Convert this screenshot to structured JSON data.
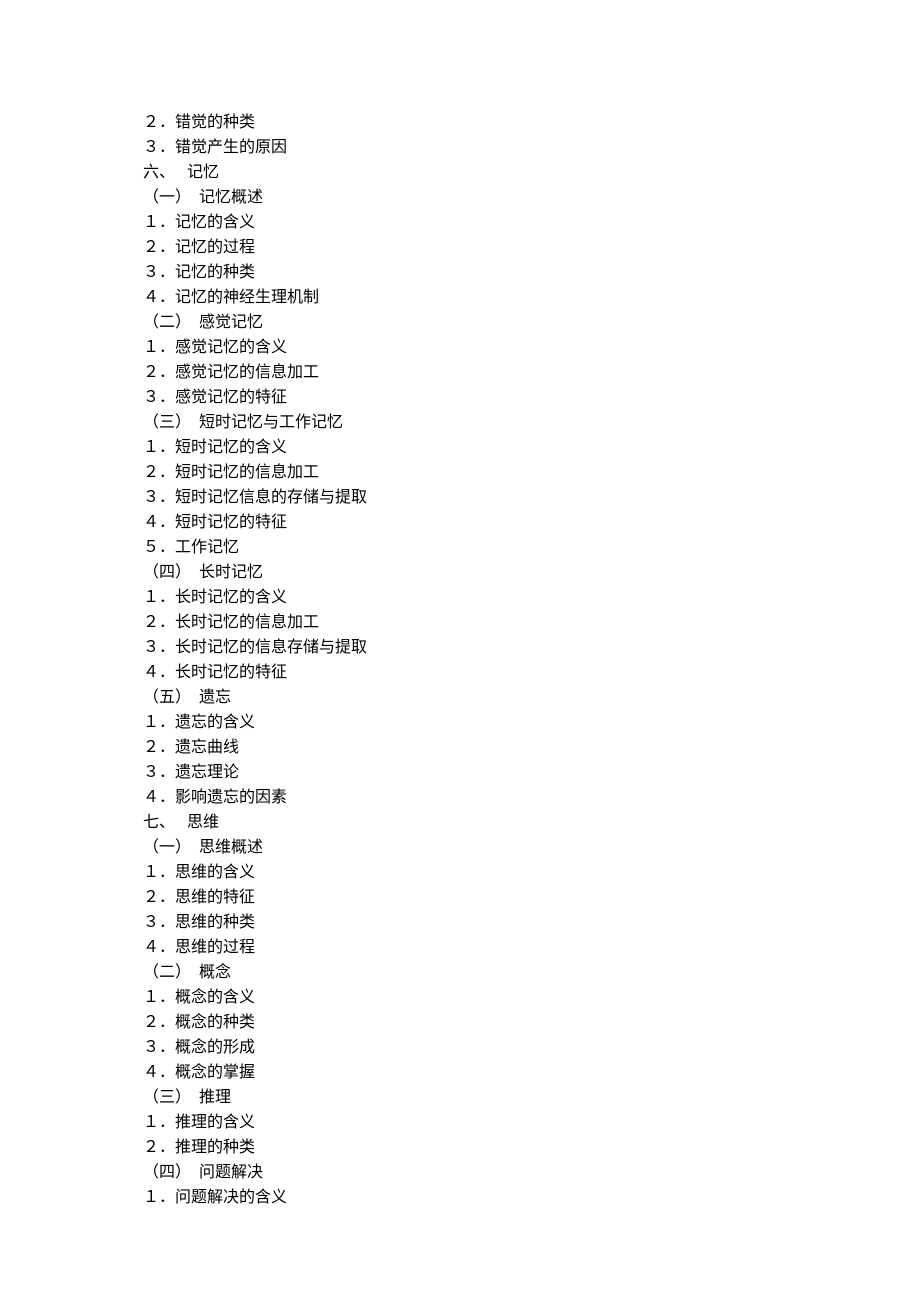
{
  "lines": [
    "２．错觉的种类",
    "３．错觉产生的原因",
    "六、   记忆",
    "（一）  记忆概述",
    "１．记忆的含义",
    "２．记忆的过程",
    "３．记忆的种类",
    "４．记忆的神经生理机制",
    "（二）  感觉记忆",
    "１．感觉记忆的含义",
    "２．感觉记忆的信息加工",
    "３．感觉记忆的特征",
    "（三）  短时记忆与工作记忆",
    "１．短时记忆的含义",
    "２．短时记忆的信息加工",
    "３．短时记忆信息的存储与提取",
    "４．短时记忆的特征",
    "５．工作记忆",
    "（四）  长时记忆",
    "１．长时记忆的含义",
    "２．长时记忆的信息加工",
    "３．长时记忆的信息存储与提取",
    "４．长时记忆的特征",
    "（五）  遗忘",
    "１．遗忘的含义",
    "２．遗忘曲线",
    "３．遗忘理论",
    "４．影响遗忘的因素",
    "七、   思维",
    "（一）  思维概述",
    "１．思维的含义",
    "２．思维的特征",
    "３．思维的种类",
    "４．思维的过程",
    "（二）  概念",
    "１．概念的含义",
    "２．概念的种类",
    "３．概念的形成",
    "４．概念的掌握",
    "（三）  推理",
    "１．推理的含义",
    "２．推理的种类",
    "（四）  问题解决",
    "１．问题解决的含义"
  ]
}
